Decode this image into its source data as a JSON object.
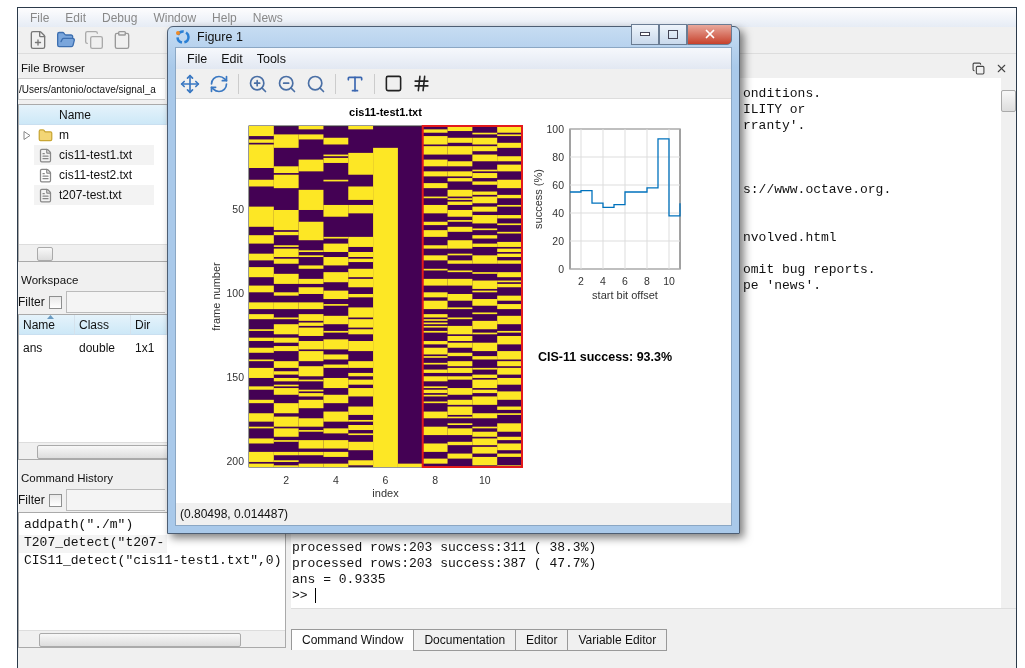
{
  "main_window": {
    "menu": [
      "File",
      "Edit",
      "Debug",
      "Window",
      "Help",
      "News"
    ],
    "file_browser": {
      "title": "File Browser",
      "path": "/Users/antonio/octave/signal_a",
      "column": "Name",
      "items": [
        {
          "kind": "folder",
          "name": "m",
          "expanded": false
        },
        {
          "kind": "file",
          "name": "cis11-test1.txt"
        },
        {
          "kind": "file",
          "name": "cis11-test2.txt"
        },
        {
          "kind": "file",
          "name": "t207-test.txt"
        }
      ]
    },
    "workspace": {
      "title": "Workspace",
      "filter_label": "Filter",
      "filter_checked": false,
      "columns": [
        "Name",
        "Class",
        "Dir"
      ],
      "rows": [
        [
          "ans",
          "double",
          "1x1"
        ]
      ]
    },
    "command_history": {
      "title": "Command History",
      "filter_label": "Filter",
      "filter_checked": false,
      "entries": [
        "addpath(\"./m\")",
        "T207_detect(\"t207-",
        "CIS11_detect(\"cis11-test1.txt\",0)"
      ]
    },
    "command_window": {
      "lines": [
        {
          "kind": "clipped",
          "text": "onditions."
        },
        {
          "kind": "clipped",
          "text": "ILITY or"
        },
        {
          "kind": "clipped",
          "text": "rranty'."
        },
        {
          "kind": "clipped",
          "text": "s://www.octave.org."
        },
        {
          "kind": "clipped",
          "text": "nvolved.html"
        },
        {
          "kind": "clipped",
          "text": "omit bug reports."
        },
        {
          "kind": "clipped",
          "text": "pe 'news'."
        },
        {
          "kind": "full",
          "text": "processed rows:203 success:311 ( 38.3%)"
        },
        {
          "kind": "full",
          "text": "processed rows:203 success:387 ( 47.7%)"
        },
        {
          "kind": "full",
          "text": "ans = 0.9335"
        }
      ],
      "prompt": ">>"
    },
    "tabs": [
      {
        "label": "Command Window",
        "selected": true
      },
      {
        "label": "Documentation",
        "selected": false
      },
      {
        "label": "Editor",
        "selected": false
      },
      {
        "label": "Variable Editor",
        "selected": false
      }
    ]
  },
  "figure": {
    "title": "Figure 1",
    "menu": [
      "File",
      "Edit",
      "Tools"
    ],
    "image_plot": {
      "title": "cis11-test1.txt",
      "xlabel": "index",
      "ylabel": "frame number",
      "xticks": [
        "2",
        "4",
        "6",
        "8",
        "10"
      ],
      "yticks": [
        "50",
        "100",
        "150",
        "200"
      ]
    },
    "chart_data": {
      "type": "line",
      "xlabel": "start bit offset",
      "ylabel": "success (%)",
      "x": [
        1,
        2,
        2,
        3,
        3,
        4,
        4,
        5,
        5,
        6,
        6,
        7,
        7,
        8,
        8,
        9,
        9,
        10,
        10,
        11,
        11
      ],
      "series": [
        {
          "color": "#0072bd",
          "values": [
            55,
            55,
            56,
            56,
            47,
            47,
            44,
            44,
            46,
            46,
            55,
            55,
            55,
            55,
            58,
            58,
            93,
            93,
            38,
            38,
            47
          ]
        }
      ],
      "xlim": [
        1,
        11
      ],
      "ylim": [
        0,
        100
      ],
      "xticks": [
        2,
        4,
        6,
        8,
        10
      ],
      "yticks": [
        0,
        20,
        40,
        60,
        80,
        100
      ],
      "grid": true
    },
    "annotation": "CIS-11 success: 93.3%",
    "status": "(0.80498, 0.014487)"
  }
}
